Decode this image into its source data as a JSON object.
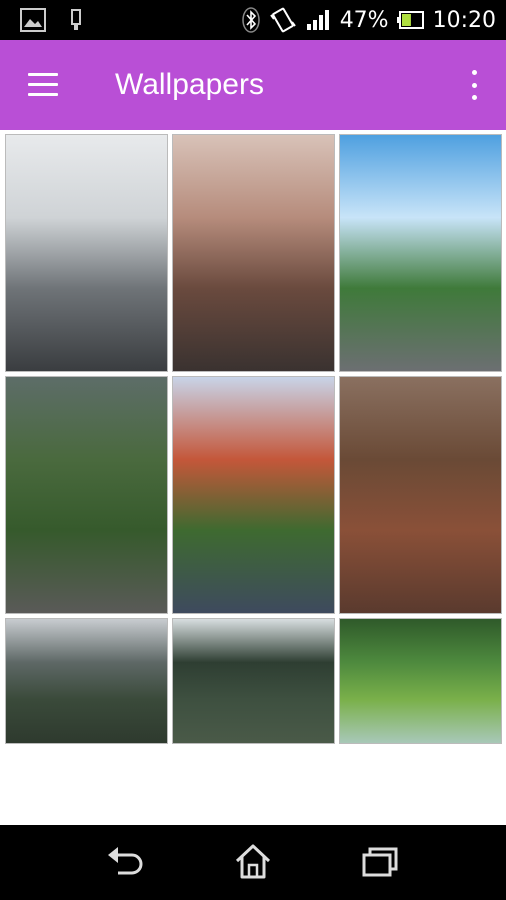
{
  "status_bar": {
    "battery_percent": "47%",
    "time": "10:20",
    "icons": [
      "image-notification-icon",
      "usb-icon",
      "bluetooth-icon",
      "vibrate-icon",
      "signal-icon",
      "battery-icon"
    ],
    "battery_level": 0.47
  },
  "app_bar": {
    "title": "Wallpapers",
    "background": "#b94fd6",
    "menu_icon": "hamburger-menu-icon",
    "overflow_icon": "more-vert-icon"
  },
  "wallpapers": [
    {
      "name": "snowy-road",
      "colors": [
        "#e8eaec",
        "#cfd3d6",
        "#6f7478",
        "#3a3d40"
      ]
    },
    {
      "name": "street-lamp-sunset",
      "colors": [
        "#d8c2b8",
        "#b68c7c",
        "#6a4a3e",
        "#3a3230"
      ]
    },
    {
      "name": "mountain-road-sky",
      "colors": [
        "#4fa0e0",
        "#c8e4f8",
        "#3f7a3a",
        "#6c6f72"
      ]
    },
    {
      "name": "green-mountain-road",
      "colors": [
        "#5d6d68",
        "#4a6a3e",
        "#365a2c",
        "#5a5a58"
      ]
    },
    {
      "name": "red-rock-road",
      "colors": [
        "#c8d4e8",
        "#c4573a",
        "#3e6a30",
        "#3e4a5e"
      ]
    },
    {
      "name": "forest-railway",
      "colors": [
        "#8a7060",
        "#6a4a36",
        "#8a5038",
        "#5a3a2e"
      ]
    },
    {
      "name": "foggy-mountains",
      "colors": [
        "#c8ccd0",
        "#5e6866",
        "#3a4a3a",
        "#2e3a2e"
      ]
    },
    {
      "name": "pine-trees",
      "colors": [
        "#d8dee0",
        "#2e3e32",
        "#3e5040",
        "#4a5a48"
      ]
    },
    {
      "name": "aerial-river-forest",
      "colors": [
        "#2f5a2a",
        "#4e8a3e",
        "#7ab04a",
        "#a8c8b8"
      ]
    }
  ],
  "nav_bar": {
    "buttons": [
      "back-icon",
      "home-icon",
      "recent-apps-icon"
    ]
  }
}
